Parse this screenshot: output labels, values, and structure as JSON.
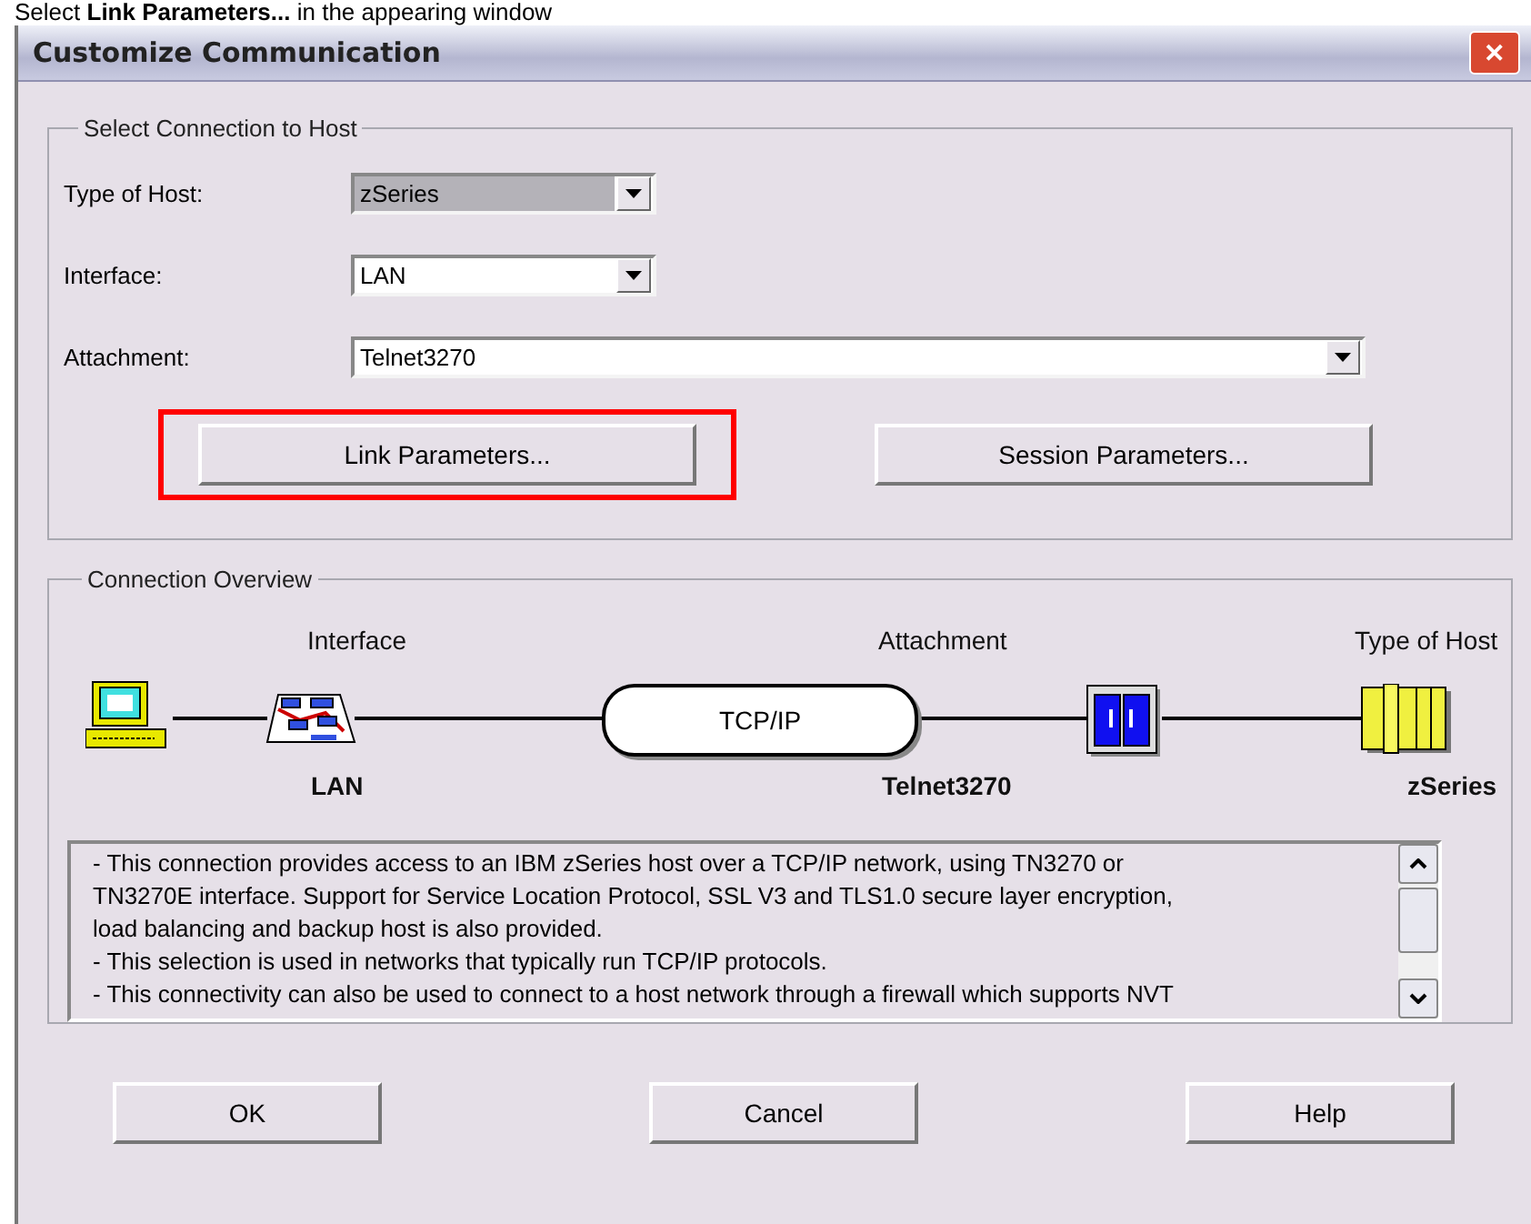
{
  "caption": "Select **Link Parameters...** in the appearing window",
  "window": {
    "title": "Customize Communication",
    "close": "✕"
  },
  "connection_group": {
    "title": "Select Connection to Host",
    "fields": [
      {
        "label": "Type of Host:",
        "value": "zSeries",
        "kind": "short",
        "highlighted": true
      },
      {
        "label": "Interface:",
        "value": "LAN",
        "kind": "short",
        "highlighted": false
      },
      {
        "label": "Attachment:",
        "value": "Telnet3270",
        "kind": "wide",
        "highlighted": false
      }
    ],
    "buttons": [
      {
        "label": "Link Parameters...",
        "highlighted": true
      },
      {
        "label": "Session Parameters...",
        "highlighted": false
      }
    ]
  },
  "overview_group": {
    "title": "Connection Overview",
    "diagram": {
      "interface_title": "Interface",
      "interface_value": "LAN",
      "attachment_title": "Attachment",
      "protocol": "TCP/IP",
      "attachment_value": "Telnet3270",
      "host_title": "Type of Host",
      "host_value": "zSeries"
    },
    "description_lines": [
      "- This connection provides access to an IBM zSeries host over a TCP/IP network, using TN3270 or",
      "TN3270E interface. Support for Service Location Protocol, SSL V3  and TLS1.0 secure layer encryption,",
      "load balancing and backup host is also provided.",
      "- This selection is used in networks that typically run TCP/IP protocols.",
      "- This connectivity can also be used to connect to a host network through a  firewall which supports NVT"
    ]
  },
  "buttons": [
    "OK",
    "Cancel",
    "Help"
  ]
}
